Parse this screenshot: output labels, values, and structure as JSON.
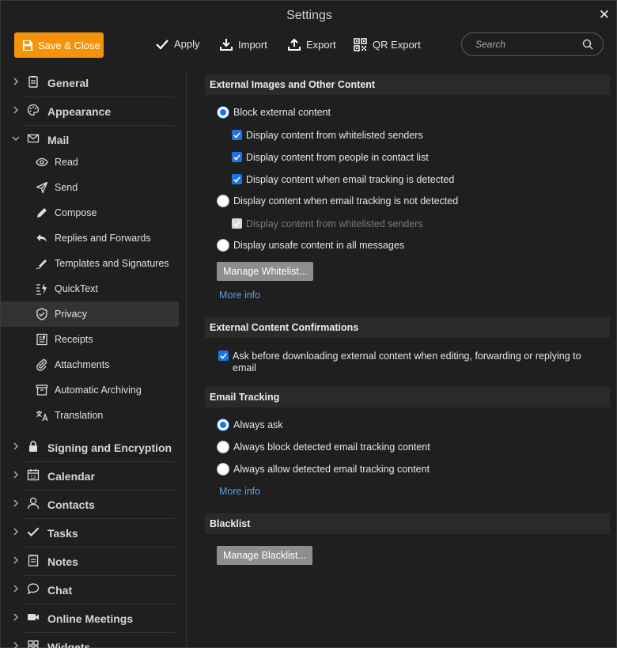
{
  "window": {
    "title": "Settings"
  },
  "toolbar": {
    "save_close": "Save & Close",
    "apply": "Apply",
    "import": "Import",
    "export": "Export",
    "qr_export": "QR Export",
    "search_placeholder": "Search"
  },
  "sidebar": {
    "general": "General",
    "appearance": "Appearance",
    "mail": "Mail",
    "mail_items": [
      "Read",
      "Send",
      "Compose",
      "Replies and Forwards",
      "Templates and Signatures",
      "QuickText",
      "Privacy",
      "Receipts",
      "Attachments",
      "Automatic Archiving",
      "Translation"
    ],
    "active_item": "Privacy",
    "signing": "Signing and Encryption",
    "calendar": "Calendar",
    "contacts": "Contacts",
    "tasks": "Tasks",
    "notes": "Notes",
    "chat": "Chat",
    "meetings": "Online Meetings",
    "widgets": "Widgets"
  },
  "content": {
    "ext_images": {
      "header": "External Images and Other Content",
      "block": "Block external content",
      "cb_whitelisted": "Display content from whitelisted senders",
      "cb_contacts": "Display content from people in contact list",
      "cb_tracking": "Display content when email tracking is detected",
      "not_detected": "Display content when email tracking is not detected",
      "cb_whitelisted_disabled": "Display content from whitelisted senders",
      "unsafe": "Display unsafe content in all messages",
      "manage_whitelist": "Manage Whitelist...",
      "more_info": "More info"
    },
    "confirmations": {
      "header": "External Content Confirmations",
      "ask_line1": "Ask before downloading external content when editing, forwarding or replying to",
      "ask_line2": "email"
    },
    "tracking": {
      "header": "Email Tracking",
      "always_ask": "Always ask",
      "always_block": "Always block detected email tracking content",
      "always_allow": "Always allow detected email tracking content",
      "more_info": "More info"
    },
    "blacklist": {
      "header": "Blacklist",
      "manage_blacklist": "Manage Blacklist..."
    }
  },
  "colors": {
    "accent": "#f5940a",
    "checkbox": "#1a73e8",
    "link": "#5a9ee8",
    "background": "#1f1f1f"
  }
}
